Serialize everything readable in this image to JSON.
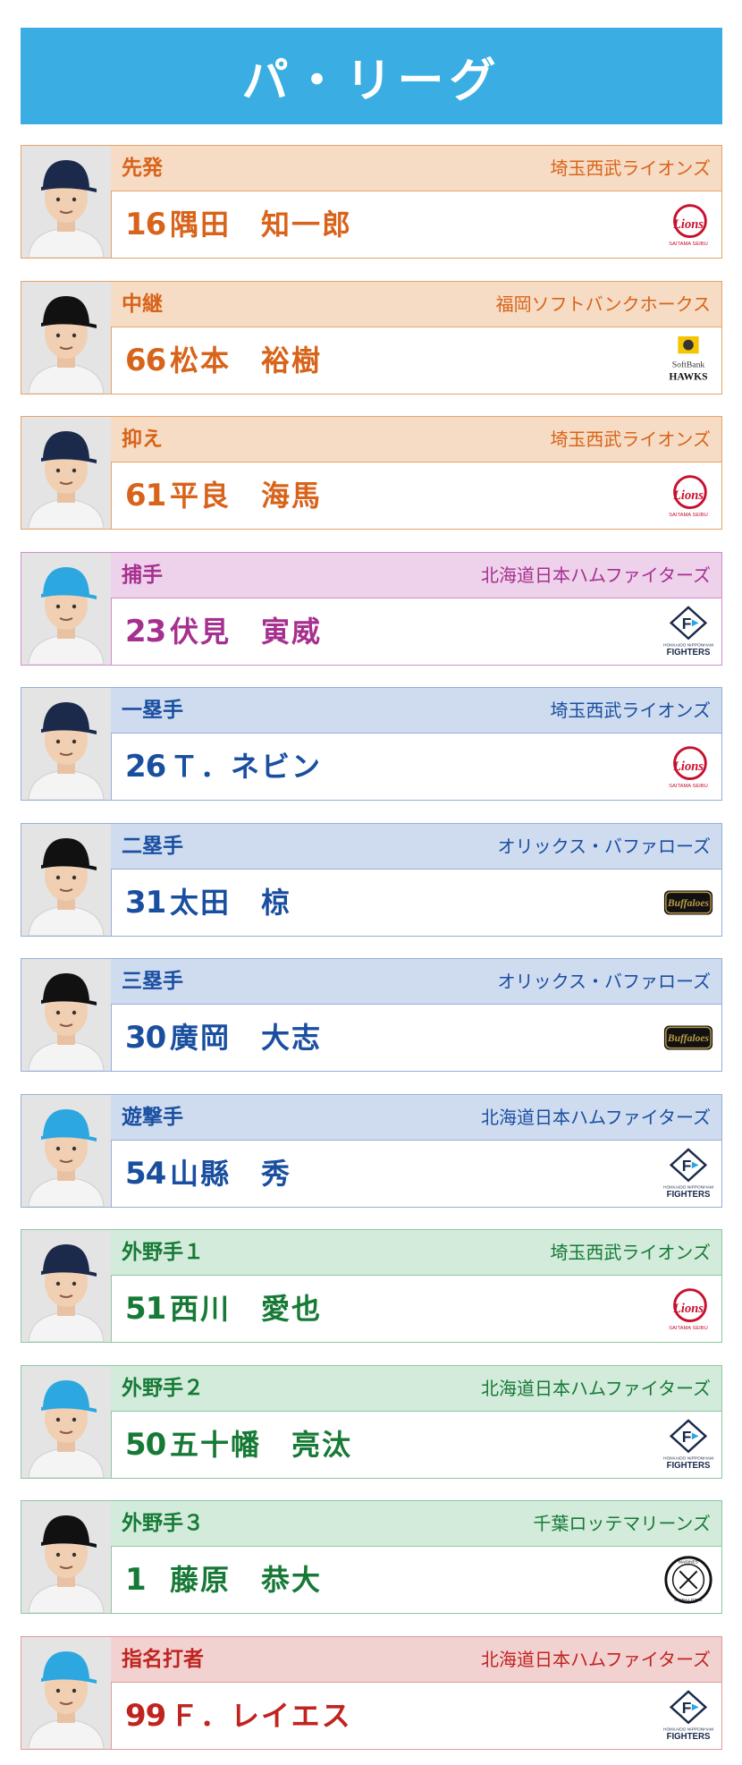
{
  "header": {
    "title": "パ・リーグ"
  },
  "players": [
    {
      "position": "先発",
      "team": "埼玉西武ライオンズ",
      "number": "16",
      "name": "隅田　知一郎",
      "group": "pitch",
      "team_logo": "lions-logo-icon"
    },
    {
      "position": "中継",
      "team": "福岡ソフトバンクホークス",
      "number": "66",
      "name": "松本　裕樹",
      "group": "pitch",
      "team_logo": "hawks-logo-icon"
    },
    {
      "position": "抑え",
      "team": "埼玉西武ライオンズ",
      "number": "61",
      "name": "平良　海馬",
      "group": "pitch",
      "team_logo": "lions-logo-icon"
    },
    {
      "position": "捕手",
      "team": "北海道日本ハムファイターズ",
      "number": "23",
      "name": "伏見　寅威",
      "group": "catch",
      "team_logo": "fighters-logo-icon"
    },
    {
      "position": "一塁手",
      "team": "埼玉西武ライオンズ",
      "number": "26",
      "name": "Ｔ．ネビン",
      "group": "infield",
      "team_logo": "lions-logo-icon"
    },
    {
      "position": "二塁手",
      "team": "オリックス・バファローズ",
      "number": "31",
      "name": "太田　椋",
      "group": "infield",
      "team_logo": "buffaloes-logo-icon"
    },
    {
      "position": "三塁手",
      "team": "オリックス・バファローズ",
      "number": "30",
      "name": "廣岡　大志",
      "group": "infield",
      "team_logo": "buffaloes-logo-icon"
    },
    {
      "position": "遊撃手",
      "team": "北海道日本ハムファイターズ",
      "number": "54",
      "name": "山縣　秀",
      "group": "infield",
      "team_logo": "fighters-logo-icon"
    },
    {
      "position": "外野手１",
      "team": "埼玉西武ライオンズ",
      "number": "51",
      "name": "西川　愛也",
      "group": "outfield",
      "team_logo": "lions-logo-icon"
    },
    {
      "position": "外野手２",
      "team": "北海道日本ハムファイターズ",
      "number": "50",
      "name": "五十幡　亮汰",
      "group": "outfield",
      "team_logo": "fighters-logo-icon"
    },
    {
      "position": "外野手３",
      "team": "千葉ロッテマリーンズ",
      "number": "1",
      "name": "藤原　恭大",
      "group": "outfield",
      "team_logo": "marines-logo-icon"
    },
    {
      "position": "指名打者",
      "team": "北海道日本ハムファイターズ",
      "number": "99",
      "name": "Ｆ．レイエス",
      "group": "dh",
      "team_logo": "fighters-logo-icon"
    }
  ]
}
